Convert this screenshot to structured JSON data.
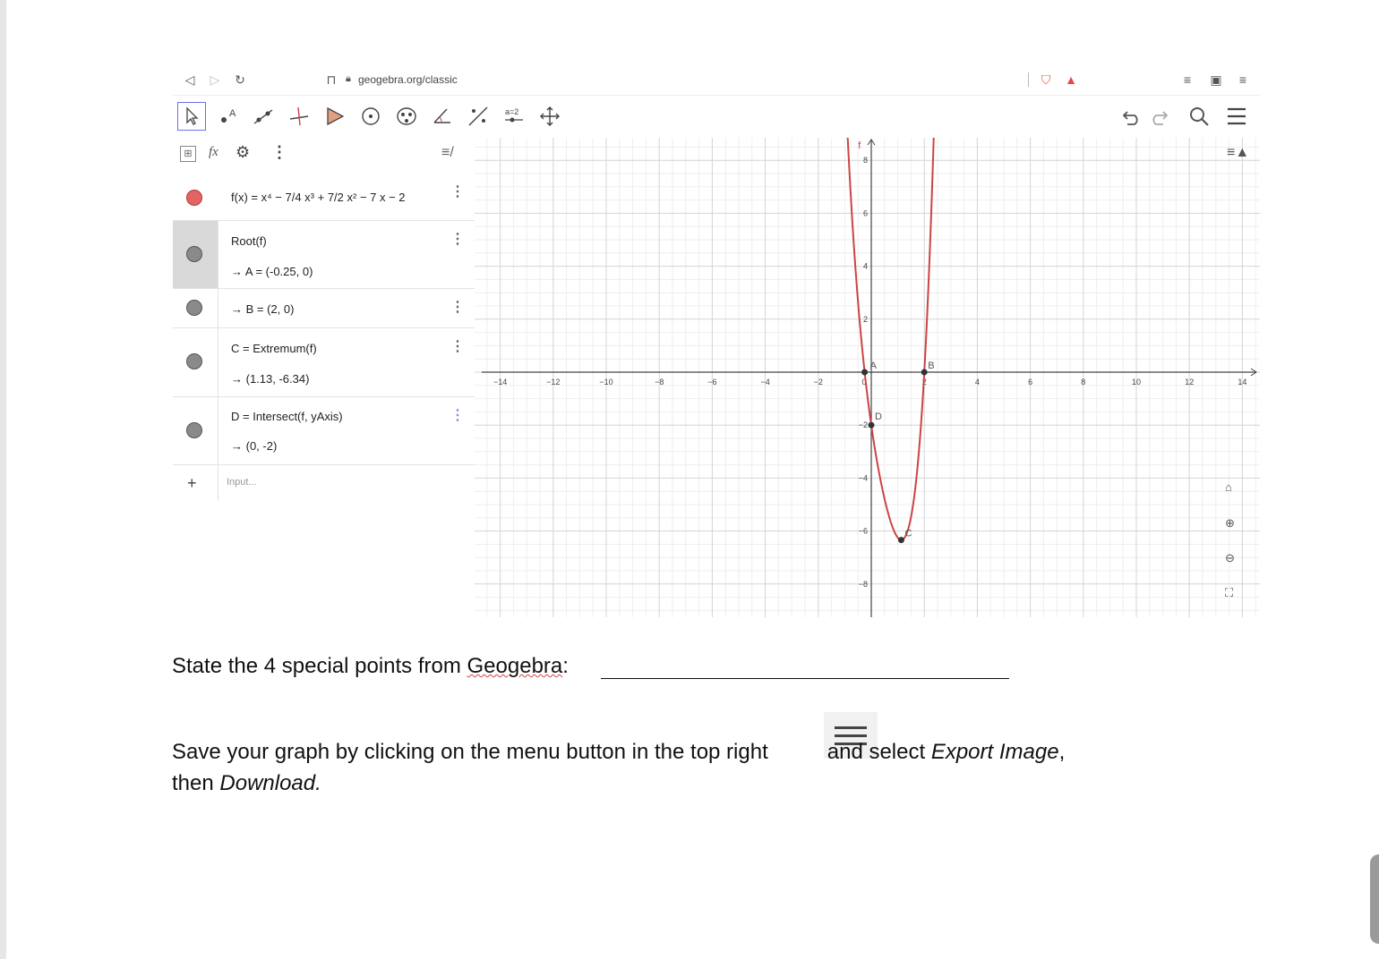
{
  "browser": {
    "url": "geogebra.org/classic"
  },
  "algebra": {
    "rows": [
      {
        "name": "function-f",
        "line1": "f(x) = x⁴ − 7/4 x³ + 7/2 x² − 7 x − 2",
        "line2": "",
        "color": "#e06666"
      },
      {
        "name": "root",
        "line1": "Root(f)",
        "line2": "→ A = (-0.25, 0)",
        "color": "#808080"
      },
      {
        "name": "point-b",
        "line1": "→ B = (2, 0)",
        "line2": "",
        "color": "#808080"
      },
      {
        "name": "extremum",
        "line1": "C = Extremum(f)",
        "line2": "→ (1.13, -6.34)",
        "color": "#808080"
      },
      {
        "name": "intersect",
        "line1": "D = Intersect(f, yAxis)",
        "line2": "→ (0, -2)",
        "color": "#808080"
      }
    ],
    "input_placeholder": "Input..."
  },
  "graph": {
    "function_label": "f",
    "x_ticks": [
      "−14",
      "−12",
      "−10",
      "−8",
      "−6",
      "−4",
      "−2",
      "0",
      "2",
      "4",
      "6",
      "8",
      "10",
      "12",
      "14"
    ],
    "y_ticks": [
      "8",
      "6",
      "4",
      "2",
      "−2",
      "−4",
      "−6",
      "−8"
    ],
    "points": [
      {
        "label": "A",
        "x": -0.25,
        "y": 0
      },
      {
        "label": "B",
        "x": 2,
        "y": 0
      },
      {
        "label": "C",
        "x": 1.13,
        "y": -6.34
      },
      {
        "label": "D",
        "x": 0,
        "y": -2
      }
    ],
    "curve_color": "#cc4444"
  },
  "question1": {
    "prefix": "State the 4 special points from ",
    "underlined": "Geogebra",
    "suffix": ":"
  },
  "question2": {
    "part1": "Save your graph by clicking on the menu button in the top right",
    "part2": "and select ",
    "italic1": "Export Image",
    "part3": ",",
    "part4": "then ",
    "italic2": "Download."
  }
}
